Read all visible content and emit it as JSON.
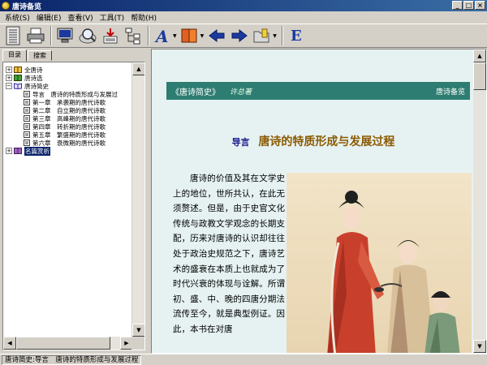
{
  "window": {
    "title": "唐诗备览"
  },
  "menu": [
    {
      "label": "系统(S)"
    },
    {
      "label": "编辑(E)"
    },
    {
      "label": "查看(V)"
    },
    {
      "label": "工具(T)"
    },
    {
      "label": "帮助(H)"
    }
  ],
  "toolbar": {
    "buttons": [
      {
        "icon": "book-list-icon"
      },
      {
        "icon": "printer-icon"
      },
      {
        "icon": "monitor-icon"
      },
      {
        "icon": "search-magnifier-icon"
      },
      {
        "icon": "download-icon"
      },
      {
        "icon": "tree-view-icon"
      },
      {
        "icon": "font-icon"
      },
      {
        "icon": "books-icon"
      },
      {
        "icon": "back-arrow-icon"
      },
      {
        "icon": "forward-arrow-icon"
      },
      {
        "icon": "bookmark-folder-icon"
      },
      {
        "icon": "english-icon"
      }
    ],
    "english_label": "E"
  },
  "left": {
    "tabs": [
      {
        "label": "目录"
      },
      {
        "label": "搜索"
      }
    ],
    "tree": [
      {
        "label": "全唐诗",
        "expander": "+",
        "level": 0
      },
      {
        "label": "唐诗选",
        "expander": "+",
        "level": 0
      },
      {
        "label": "唐诗简史",
        "expander": "−",
        "level": 0
      },
      {
        "label": "导言　唐诗的特质形成与发展过",
        "level": 1
      },
      {
        "label": "第一章　承袭期的唐代诗歌",
        "level": 1
      },
      {
        "label": "第二章　自立期的唐代诗歌",
        "level": 1
      },
      {
        "label": "第三章　高峰期的唐代诗歌",
        "level": 1
      },
      {
        "label": "第四章　转折期的唐代诗歌",
        "level": 1
      },
      {
        "label": "第五章　繁盛期的唐代诗歌",
        "level": 1
      },
      {
        "label": "第六章　衰微期的唐代诗歌",
        "level": 1
      },
      {
        "label": "名篇赏析",
        "expander": "+",
        "level": 0,
        "selected": true
      }
    ]
  },
  "content": {
    "header": {
      "book_title": "《唐诗简史》",
      "author": "许总著",
      "series": "唐诗备览"
    },
    "chapter": {
      "label": "导言",
      "title": "唐诗的特质形成与发展过程"
    },
    "body": "唐诗的价值及其在文学史上的地位，世所共认，在此无须赘述。但是，由于史官文化传统与政教文学观念的长期支配，历来对唐诗的认识却往往处于政治史规范之下，唐诗艺术的盛衰在本质上也就成为了时代兴衰的体现与诠解。所谓初、盛、中、晚的四唐分期法流传至今，就是典型例证。因此，本书在对唐"
  },
  "status": {
    "text": "唐诗简史:导言　唐诗的特质形成与发展过程"
  },
  "colors": {
    "header_bg": "#2e7d72",
    "content_bg": "#e6f2f2",
    "chapter_label": "#1a1a8c",
    "chapter_title": "#8b5a00",
    "titlebar": "#0a246a"
  }
}
